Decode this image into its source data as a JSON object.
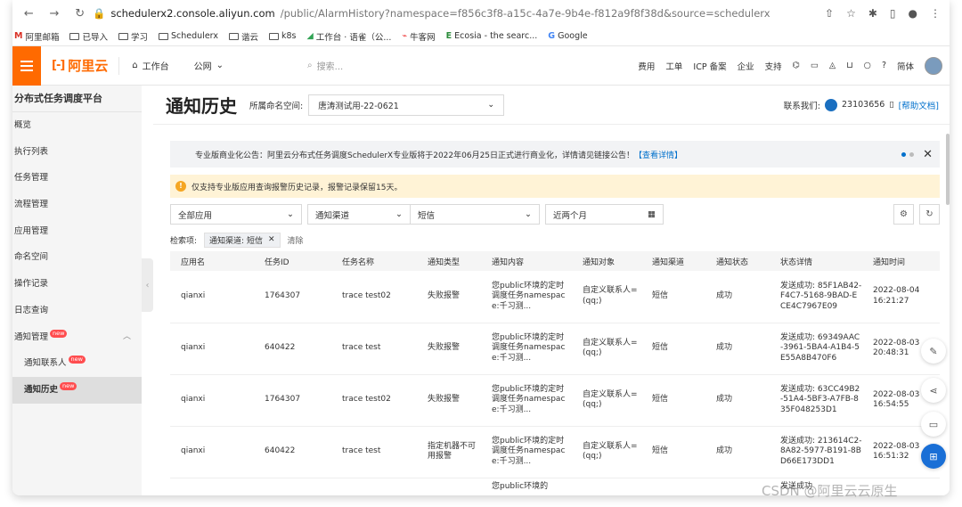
{
  "browser": {
    "url_host": "schedulerx2.console.aliyun.com",
    "url_path": "/public/AlarmHistory?namespace=f856c3f8-a15c-4a7e-9b4e-f812a9f8f38d&source=schedulerx",
    "bookmarks": [
      "阿里邮箱",
      "已导入",
      "学习",
      "Schedulerx",
      "谐云",
      "k8s",
      "工作台 · 语雀（公...",
      "牛客网",
      "Ecosia - the searc...",
      "Google"
    ]
  },
  "topbar": {
    "logo": "阿里云",
    "workbench": "工作台",
    "region": "公网",
    "search_placeholder": "搜索...",
    "links": [
      "费用",
      "工单",
      "ICP 备案",
      "企业",
      "支持"
    ],
    "lang": "简体"
  },
  "sidebar": {
    "title": "分布式任务调度平台",
    "items": [
      {
        "label": "概览"
      },
      {
        "label": "执行列表"
      },
      {
        "label": "任务管理"
      },
      {
        "label": "流程管理"
      },
      {
        "label": "应用管理"
      },
      {
        "label": "命名空间"
      },
      {
        "label": "操作记录"
      },
      {
        "label": "日志查询"
      }
    ],
    "group": {
      "label": "通知管理",
      "badge": "new"
    },
    "sub_items": [
      {
        "label": "通知联系人",
        "badge": "new"
      },
      {
        "label": "通知历史",
        "badge": "new"
      }
    ]
  },
  "page": {
    "title": "通知历史",
    "ns_label": "所属命名空间:",
    "ns_value": "唐涛测试用-22-0621",
    "contact_label": "联系我们:",
    "contact_qq": "23103656",
    "help_link": "[帮助文档]"
  },
  "notice": {
    "text": "专业版商业化公告：阿里云分布式任务调度SchedulerX专业版将于2022年06月25日正式进行商业化，详情请见链接公告！",
    "link": "【查看详情】"
  },
  "warning": "仅支持专业版应用查询报警历史记录，报警记录保留15天。",
  "filters": {
    "app": "全部应用",
    "channel": "通知渠道",
    "channel_value": "短信",
    "range": "近两个月"
  },
  "conditions": {
    "label": "检索项:",
    "tag": "通知渠道: 短信",
    "clear": "清除"
  },
  "table": {
    "headers": [
      "应用名",
      "任务ID",
      "任务名称",
      "通知类型",
      "通知内容",
      "通知对象",
      "通知渠道",
      "通知状态",
      "状态详情",
      "通知时间"
    ],
    "rows": [
      {
        "app": "qianxi",
        "id": "1764307",
        "name": "trace test02",
        "type": "失败报警",
        "content": "您public环境的定时调度任务namespace:千习测...",
        "target": "自定义联系人=(qq;)",
        "channel": "短信",
        "status": "成功",
        "detail": "发送成功: 85F1AB42-F4C7-5168-9BAD-ECE4C7967E09",
        "time": "2022-08-04 16:21:27"
      },
      {
        "app": "qianxi",
        "id": "640422",
        "name": "trace test",
        "type": "失败报警",
        "content": "您public环境的定时调度任务namespace:千习测...",
        "target": "自定义联系人=(qq;)",
        "channel": "短信",
        "status": "成功",
        "detail": "发送成功: 69349AAC-3961-5BA4-A1B4-5E55A8B470F6",
        "time": "2022-08-03 20:48:31"
      },
      {
        "app": "qianxi",
        "id": "1764307",
        "name": "trace test02",
        "type": "失败报警",
        "content": "您public环境的定时调度任务namespace:千习测...",
        "target": "自定义联系人=(qq;)",
        "channel": "短信",
        "status": "成功",
        "detail": "发送成功: 63CC49B2-51A4-5BF3-A7FB-835F048253D1",
        "time": "2022-08-03 16:54:55"
      },
      {
        "app": "qianxi",
        "id": "640422",
        "name": "trace test",
        "type": "指定机器不可用报警",
        "content": "您public环境的定时调度任务namespace:千习测...",
        "target": "自定义联系人=(qq;)",
        "channel": "短信",
        "status": "成功",
        "detail": "发送成功: 213614C2-8A82-5977-B191-8BD66E173DD1",
        "time": "2022-08-03 16:51:32"
      }
    ],
    "partial_row_content": "您public环境的",
    "partial_row_detail": "发送成功"
  },
  "watermark": "CSDN @阿里云云原生"
}
